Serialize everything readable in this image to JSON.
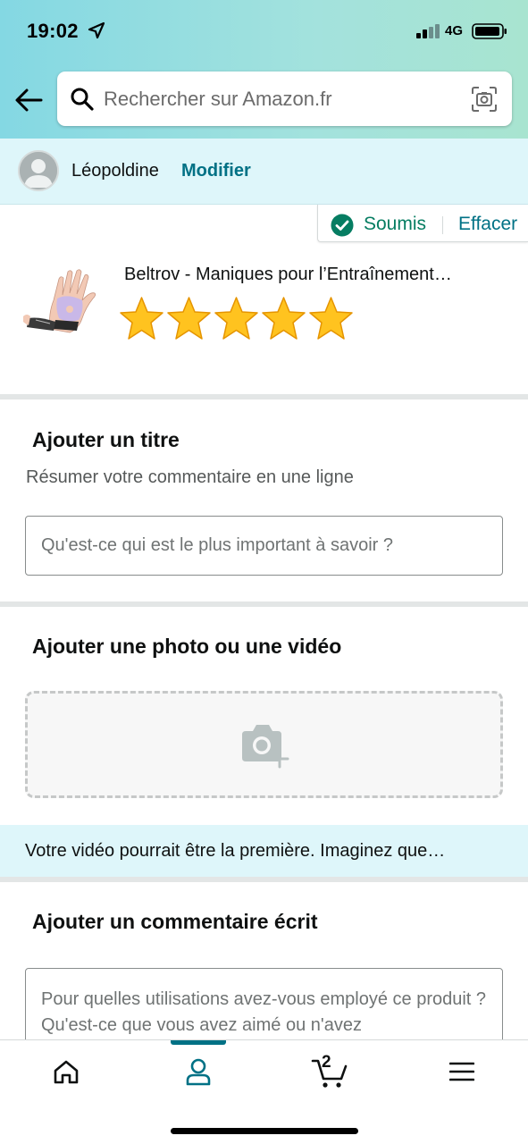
{
  "status_bar": {
    "time": "19:02",
    "network": "4G"
  },
  "search": {
    "placeholder": "Rechercher sur Amazon.fr"
  },
  "profile": {
    "name": "Léopoldine",
    "modify_label": "Modifier"
  },
  "review_status": {
    "submitted_label": "Soumis",
    "clear_label": "Effacer"
  },
  "product": {
    "title": "Beltrov - Maniques pour l’Entraînement…",
    "rating": 5,
    "rating_max": 5
  },
  "title_section": {
    "heading": "Ajouter un titre",
    "subtitle": "Résumer votre commentaire en une ligne",
    "placeholder": "Qu'est-ce qui est le plus important à savoir ?"
  },
  "media_section": {
    "heading": "Ajouter une photo ou une vidéo",
    "banner_text": "Votre vidéo pourrait être la première. Imaginez que…"
  },
  "written_section": {
    "heading": "Ajouter un commentaire écrit",
    "placeholder": "Pour quelles utilisations avez-vous employé ce produit ? Qu'est-ce que vous avez aimé ou n'avez"
  },
  "bottom_nav": {
    "cart_count": "2",
    "active_tab": "profile"
  },
  "colors": {
    "accent": "#007185",
    "success": "#067d62",
    "star": "#ffa41c",
    "header_start": "#84d8e3",
    "header_end": "#a8e4d0"
  }
}
